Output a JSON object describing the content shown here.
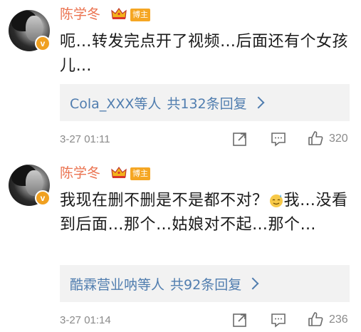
{
  "comments": [
    {
      "username": "陈学冬",
      "badge": "博主",
      "verified_mark": "v",
      "text": "呃…转发完点开了视频…后面还有个女孩儿…",
      "reply": {
        "names": "Cola_XXX等人",
        "count_text": "共132条回复"
      },
      "time": "3-27 01:11",
      "likes": "320"
    },
    {
      "username": "陈学冬",
      "badge": "博主",
      "verified_mark": "v",
      "text_before_emoji": "我现在删不删是不是都不对？",
      "emoji": "sweat-smile-emoji",
      "text_after_emoji": "我…没看到后面…那个…姑娘对不起…那个…",
      "reply": {
        "names": "酷霖营业呐等人",
        "count_text": "共92条回复"
      },
      "time": "3-27 01:14",
      "likes": "236"
    }
  ],
  "icons": [
    "crown-icon",
    "repost-icon",
    "comment-icon",
    "like-icon",
    "chevron-right-icon",
    "verified-icon"
  ],
  "colors": {
    "username": "#eb7350",
    "badge_bg": "#f5a623",
    "reply_link": "#507daf",
    "meta_gray": "#8a8a8a",
    "reply_bg": "#f2f2f2"
  }
}
